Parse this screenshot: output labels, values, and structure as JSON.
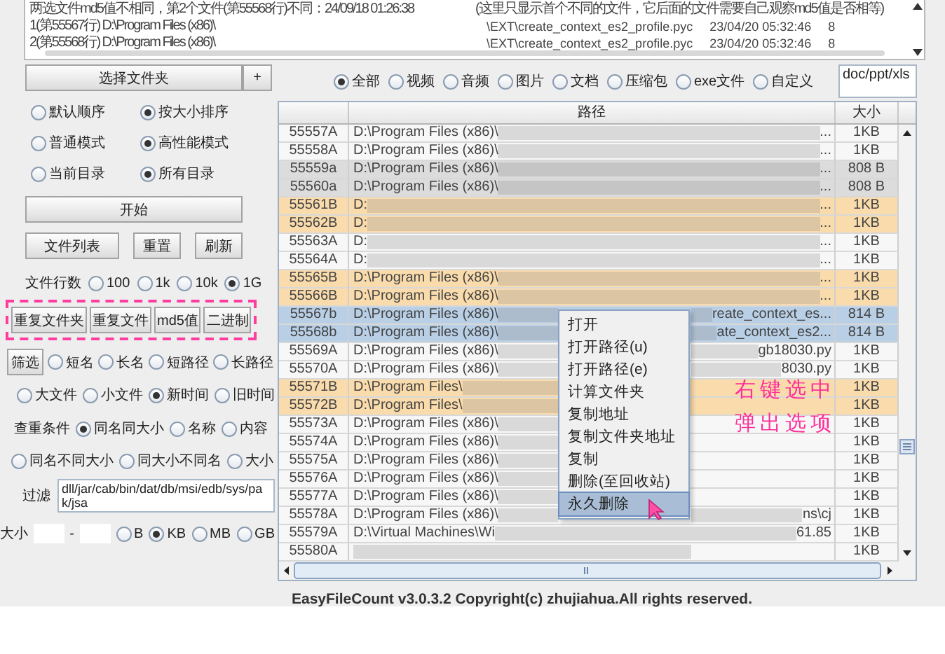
{
  "log": {
    "lines": [
      {
        "left": "两选文件md5值不相同，第2个文件(第55568行)不同：24/09/18 01:26:38",
        "right": "(这里只显示首个不同的文件，它后面的文件需要自己观察md5值是否相等)"
      },
      {
        "left": "1(第55567行) D:\\Program Files (x86)\\",
        "file": "\\EXT\\create_context_es2_profile.pyc",
        "time": "23/04/20 05:32:46",
        "extra": "8"
      },
      {
        "left": "2(第55568行) D:\\Program Files (x86)\\",
        "file": "\\EXT\\create_context_es2_profile.pyc",
        "time": "23/04/20 05:32:46",
        "extra": "8"
      }
    ]
  },
  "folder_picker": {
    "button": "选择文件夹",
    "add": "+"
  },
  "sort_options": [
    [
      {
        "label": "默认顺序",
        "selected": false
      },
      {
        "label": "按大小排序",
        "selected": true
      }
    ],
    [
      {
        "label": "普通模式",
        "selected": false
      },
      {
        "label": "高性能模式",
        "selected": true
      }
    ],
    [
      {
        "label": "当前目录",
        "selected": false
      },
      {
        "label": "所有目录",
        "selected": true
      }
    ]
  ],
  "start_button": "开始",
  "action_buttons": [
    "文件列表",
    "重置",
    "刷新"
  ],
  "line_count": {
    "label": "文件行数",
    "options": [
      {
        "label": "100",
        "selected": false
      },
      {
        "label": "1k",
        "selected": false
      },
      {
        "label": "10k",
        "selected": false
      },
      {
        "label": "1G",
        "selected": true
      }
    ]
  },
  "duplicate_buttons": [
    "重复文件夹",
    "重复文件",
    "md5值",
    "二进制"
  ],
  "filter_button": "筛选",
  "name_filters": [
    {
      "label": "短名",
      "selected": false
    },
    {
      "label": "长名",
      "selected": false
    },
    {
      "label": "短路径",
      "selected": false
    },
    {
      "label": "长路径",
      "selected": false
    }
  ],
  "time_filters": [
    {
      "label": "大文件",
      "selected": false
    },
    {
      "label": "小文件",
      "selected": false
    },
    {
      "label": "新时间",
      "selected": true
    },
    {
      "label": "旧时间",
      "selected": false
    }
  ],
  "match": {
    "label": "查重条件",
    "options": [
      {
        "label": "同名同大小",
        "selected": true
      },
      {
        "label": "名称",
        "selected": false
      },
      {
        "label": "内容",
        "selected": false
      }
    ],
    "more_options": [
      {
        "label": "同名不同大小",
        "selected": false
      },
      {
        "label": "同大小不同名",
        "selected": false
      },
      {
        "label": "大小",
        "selected": false
      }
    ]
  },
  "exclude": {
    "label": "过滤",
    "value": "dll/jar/cab/bin/dat/db/msi/edb/sys/pak/jsa"
  },
  "size_range": {
    "label": "大小",
    "separator": "-",
    "units": [
      {
        "label": "B",
        "selected": false
      },
      {
        "label": "KB",
        "selected": true
      },
      {
        "label": "MB",
        "selected": false
      },
      {
        "label": "GB",
        "selected": false
      }
    ]
  },
  "type_filter": {
    "options": [
      {
        "label": "全部",
        "selected": true
      },
      {
        "label": "视频",
        "selected": false
      },
      {
        "label": "音频",
        "selected": false
      },
      {
        "label": "图片",
        "selected": false
      },
      {
        "label": "文档",
        "selected": false
      },
      {
        "label": "压缩包",
        "selected": false
      },
      {
        "label": "exe文件",
        "selected": false
      },
      {
        "label": "自定义",
        "selected": false
      }
    ],
    "extensions": "doc/ppt/xls"
  },
  "table": {
    "path_header": "路径",
    "size_header": "大小",
    "rows": [
      {
        "id": "55557A",
        "path": "D:\\Program Files (x86)\\",
        "tail": "...",
        "size": "1KB",
        "color": "#f7f7f7",
        "selected": false
      },
      {
        "id": "55558A",
        "path": "D:\\Program Files (x86)\\",
        "tail": "...",
        "size": "1KB",
        "color": "#f7f7f7",
        "selected": false
      },
      {
        "id": "55559a",
        "path": "D:\\Program Files (x86)\\",
        "tail": "...",
        "size": "808 B",
        "color": "#dcdcdc",
        "selected": false
      },
      {
        "id": "55560a",
        "path": "D:\\Program Files (x86)\\",
        "tail": "...",
        "size": "808 B",
        "color": "#dcdcdc",
        "selected": false
      },
      {
        "id": "55561B",
        "path": "D:",
        "tail": "...",
        "size": "1KB",
        "color": "#fadcac",
        "selected": false
      },
      {
        "id": "55562B",
        "path": "D:",
        "tail": "...",
        "size": "1KB",
        "color": "#fadcac",
        "selected": false
      },
      {
        "id": "55563A",
        "path": "D:",
        "tail": "...",
        "size": "1KB",
        "color": "#f7f7f7",
        "selected": false
      },
      {
        "id": "55564A",
        "path": "D:",
        "tail": "...",
        "size": "1KB",
        "color": "#f7f7f7",
        "selected": false
      },
      {
        "id": "55565B",
        "path": "D:\\Program Files (x86)\\",
        "tail": "...",
        "size": "1KB",
        "color": "#fadcac",
        "selected": false
      },
      {
        "id": "55566B",
        "path": "D:\\Program Files (x86)\\",
        "tail": "...",
        "size": "1KB",
        "color": "#fadcac",
        "selected": false
      },
      {
        "id": "55567b",
        "path": "D:\\Program Files (x86)\\",
        "tail": "reate_context_es...",
        "size": "814 B",
        "selected": true
      },
      {
        "id": "55568b",
        "path": "D:\\Program Files (x86)\\",
        "tail": "ate_context_es2...",
        "size": "814 B",
        "selected": true
      },
      {
        "id": "55569A",
        "path": "D:\\Program Files (x86)\\",
        "tail": "gb18030.py",
        "size": "1KB",
        "color": "#f7f7f7",
        "selected": false
      },
      {
        "id": "55570A",
        "path": "D:\\Program Files (x86)\\",
        "tail": "8030.py",
        "size": "1KB",
        "color": "#f7f7f7",
        "selected": false
      },
      {
        "id": "55571B",
        "path": "D:\\Program Files\\",
        "size": "1KB",
        "color": "#fadcac",
        "selected": false
      },
      {
        "id": "55572B",
        "path": "D:\\Program Files\\",
        "size": "1KB",
        "color": "#fadcac",
        "selected": false
      },
      {
        "id": "55573A",
        "path": "D:\\Program Files (x86)\\",
        "size": "1KB",
        "color": "#f7f7f7",
        "selected": false
      },
      {
        "id": "55574A",
        "path": "D:\\Program Files (x86)\\",
        "size": "1KB",
        "color": "#f7f7f7",
        "selected": false
      },
      {
        "id": "55575A",
        "path": "D:\\Program Files (x86)\\",
        "size": "1KB",
        "color": "#f7f7f7",
        "selected": false
      },
      {
        "id": "55576A",
        "path": "D:\\Program Files (x86)\\",
        "size": "1KB",
        "color": "#f7f7f7",
        "selected": false
      },
      {
        "id": "55577A",
        "path": "D:\\Program Files (x86)\\",
        "size": "1KB",
        "color": "#f7f7f7",
        "selected": false
      },
      {
        "id": "55578A",
        "path": "D:\\Program Files (x86)\\",
        "tail": "ns\\cj",
        "size": "1KB",
        "color": "#f7f7f7",
        "selected": false
      },
      {
        "id": "55579A",
        "path": "D:\\Virtual Machines\\Wi",
        "tail": "61.85",
        "size": "1KB",
        "color": "#f7f7f7",
        "selected": false
      },
      {
        "id": "55580A",
        "size": "1KB",
        "color": "#f7f7f7",
        "selected": false
      }
    ]
  },
  "context_menu": {
    "items": [
      {
        "label": "打开",
        "selected": false
      },
      {
        "label": "打开路径(u)",
        "selected": false
      },
      {
        "label": "打开路径(e)",
        "selected": false
      },
      {
        "label": "计算文件夹",
        "selected": false
      },
      {
        "label": "复制地址",
        "selected": false
      },
      {
        "label": "复制文件夹地址",
        "selected": false
      },
      {
        "label": "复制",
        "selected": false
      },
      {
        "label": "删除(至回收站)",
        "selected": false
      },
      {
        "label": "永久删除",
        "selected": true
      }
    ]
  },
  "annotation": {
    "lines": [
      "右键选中",
      "弹出选项"
    ]
  },
  "footer": "EasyFileCount v3.0.3.2 Copyright(c) zhujiahua.All rights reserved."
}
